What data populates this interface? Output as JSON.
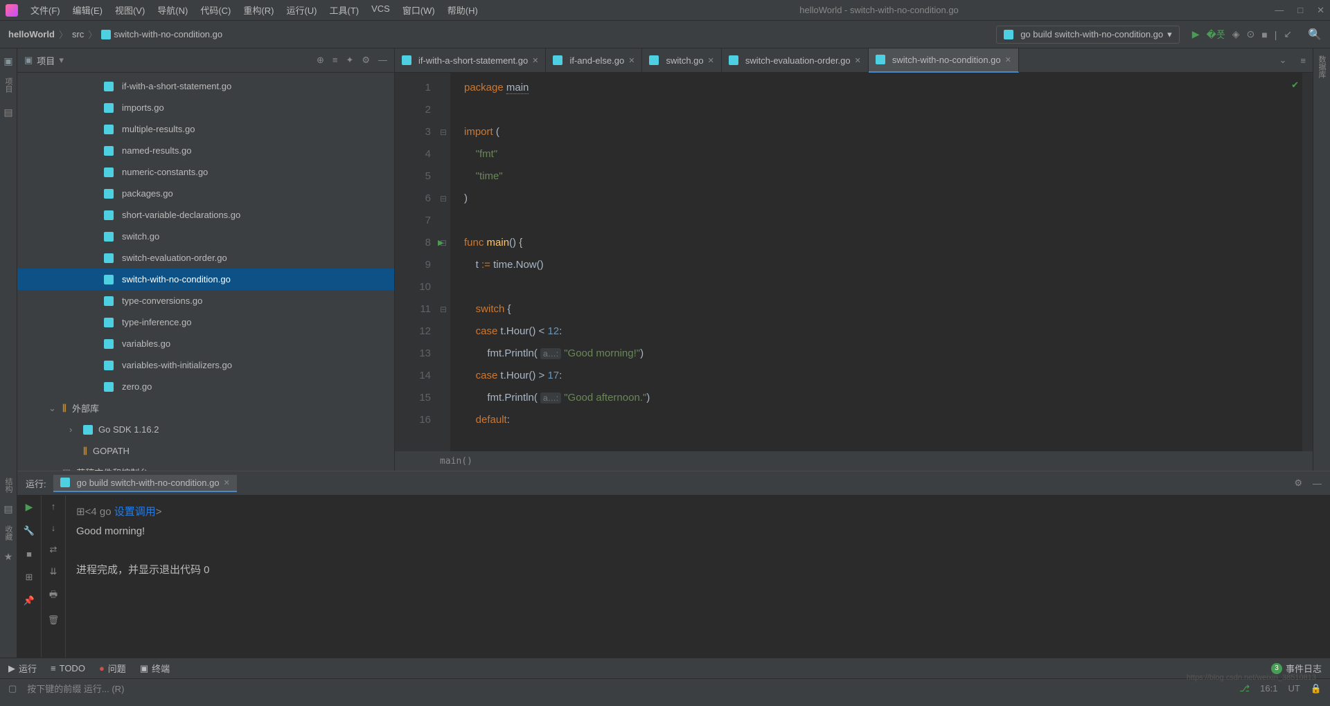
{
  "window": {
    "title": "helloWorld - switch-with-no-condition.go"
  },
  "menu": {
    "file": "文件(F)",
    "edit": "编辑(E)",
    "view": "视图(V)",
    "navigate": "导航(N)",
    "code": "代码(C)",
    "refactor": "重构(R)",
    "run": "运行(U)",
    "tools": "工具(T)",
    "vcs": "VCS",
    "window": "窗口(W)",
    "help": "帮助(H)"
  },
  "breadcrumb": {
    "project": "helloWorld",
    "folder": "src",
    "file": "switch-with-no-condition.go"
  },
  "run_config": {
    "selected": "go build switch-with-no-condition.go"
  },
  "project_panel": {
    "title": "项目",
    "files": [
      "if-with-a-short-statement.go",
      "imports.go",
      "multiple-results.go",
      "named-results.go",
      "numeric-constants.go",
      "packages.go",
      "short-variable-declarations.go",
      "switch.go",
      "switch-evaluation-order.go",
      "switch-with-no-condition.go",
      "type-conversions.go",
      "type-inference.go",
      "variables.go",
      "variables-with-initializers.go",
      "zero.go"
    ],
    "selected_index": 9,
    "external_libs": "外部库",
    "go_sdk": "Go SDK 1.16.2",
    "gopath": "GOPATH <go>",
    "scratches": "草稿文件和控制台"
  },
  "tabs": [
    "if-with-a-short-statement.go",
    "if-and-else.go",
    "switch.go",
    "switch-evaluation-order.go",
    "switch-with-no-condition.go"
  ],
  "active_tab": 4,
  "code": {
    "lines": [
      "1",
      "2",
      "3",
      "4",
      "5",
      "6",
      "7",
      "8",
      "9",
      "10",
      "11",
      "12",
      "13",
      "14",
      "15",
      "16"
    ],
    "breadcrumb": "main()"
  },
  "code_tokens": {
    "l1_package": "package ",
    "l1_main": "main",
    "l3_import": "import ",
    "l3_paren": "(",
    "l4_fmt": "    \"fmt\"",
    "l5_time": "    \"time\"",
    "l6": ")",
    "l8_func": "func ",
    "l8_main": "main",
    "l8_rest": "() {",
    "l9_pre": "    t ",
    "l9_op": ":=",
    "l9_post": " time.Now()",
    "l11_switch": "    switch ",
    "l11_brace": "{",
    "l12_case": "    case ",
    "l12_expr": "t.Hour() < ",
    "l12_num": "12",
    "l12_colon": ":",
    "l13_pre": "        fmt.Println( ",
    "l13_hint": "a…:",
    "l13_str": " \"Good morning!\"",
    "l13_end": ")",
    "l14_case": "    case ",
    "l14_expr": "t.Hour() > ",
    "l14_num": "17",
    "l14_colon": ":",
    "l15_pre": "        fmt.Println( ",
    "l15_hint": "a…:",
    "l15_str": " \"Good afternoon.\"",
    "l15_end": ")",
    "l16_default": "    default",
    "l16_colon": ":"
  },
  "run_panel": {
    "label": "运行:",
    "tab": "go build switch-with-no-condition.go",
    "first_line_prefix": "<4 go ",
    "first_line_link": "设置调用",
    "first_line_suffix": ">",
    "output1": "Good morning!",
    "output2": "进程完成，并显示退出代码 0"
  },
  "bottom_bar": {
    "run": "运行",
    "todo": "TODO",
    "problems": "问题",
    "terminal": "终端",
    "event_count": "3",
    "event_log": "事件日志"
  },
  "status_bar": {
    "hint": "按下键的前缀 运行... (R)",
    "pos": "16:1",
    "encoding": "UT",
    "watermark": "https://blog.csdn.net/weixin_38510813"
  },
  "side_labels": {
    "project_tab": "项目",
    "structure_tab": "结构",
    "favorites_tab": "收藏",
    "db_tab": "数据库"
  }
}
